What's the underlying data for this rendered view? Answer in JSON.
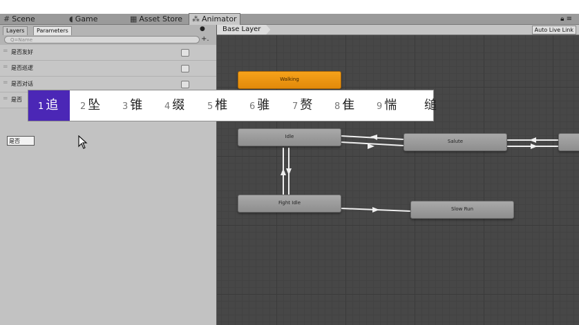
{
  "window_tabs": [
    {
      "label": "Scene",
      "icon": "grid-icon"
    },
    {
      "label": "Game",
      "icon": "pacman-icon"
    },
    {
      "label": "Asset Store",
      "icon": "store-icon"
    },
    {
      "label": "Animator",
      "icon": "animator-icon"
    }
  ],
  "parameters_panel": {
    "tabs": [
      "Layers",
      "Parameters"
    ],
    "search_placeholder": "Q=Name",
    "add_label": "+.",
    "params": [
      {
        "name": "是否友好"
      },
      {
        "name": "是否巡逻"
      },
      {
        "name": "是否对话"
      },
      {
        "name": "是否"
      }
    ],
    "rename_value": "是否"
  },
  "animator": {
    "layer": "Base Layer",
    "live_link": "Auto Live Link",
    "states": [
      {
        "name": "Walking",
        "default": true
      },
      {
        "name": "Idle",
        "default": false
      },
      {
        "name": "Salute",
        "default": false
      },
      {
        "name": "Fight Idle",
        "default": false
      },
      {
        "name": "Slow Run",
        "default": false
      }
    ]
  },
  "ime": {
    "candidates": [
      {
        "num": "1",
        "char": "追"
      },
      {
        "num": "2",
        "char": "坠"
      },
      {
        "num": "3",
        "char": "锥"
      },
      {
        "num": "4",
        "char": "缀"
      },
      {
        "num": "5",
        "char": "椎"
      },
      {
        "num": "6",
        "char": "骓"
      },
      {
        "num": "7",
        "char": "赘"
      },
      {
        "num": "8",
        "char": "隹"
      },
      {
        "num": "9",
        "char": "惴"
      },
      {
        "num": "",
        "char": "缒"
      }
    ],
    "selected_index": 0
  },
  "colors": {
    "default_state": "#f6a21a",
    "ime_highlight": "#4b27b6",
    "graph_background": "#474747"
  }
}
